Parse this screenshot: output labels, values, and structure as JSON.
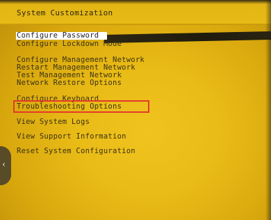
{
  "window": {
    "title": "System Customization"
  },
  "menu": {
    "items": [
      {
        "label": "Configure Password"
      },
      {
        "label": "Configure Lockdown Mode"
      },
      {
        "label": "Configure Management Network"
      },
      {
        "label": "Restart Management Network"
      },
      {
        "label": "Test Management Network"
      },
      {
        "label": "Network Restore Options"
      },
      {
        "label": "Configure Keyboard"
      },
      {
        "label": "Troubleshooting Options"
      },
      {
        "label": "View System Logs"
      },
      {
        "label": "View Support Information"
      },
      {
        "label": "Reset System Configuration"
      }
    ],
    "selected_index": 0,
    "highlighted_index": 7
  },
  "overlay": {
    "highlight_color": "#e23a2a",
    "left_edge_icon": "chevron-left-icon"
  },
  "colors": {
    "screen_background": "#e9bb16",
    "text": "#3a3114",
    "selected_background": "#ffffff"
  }
}
